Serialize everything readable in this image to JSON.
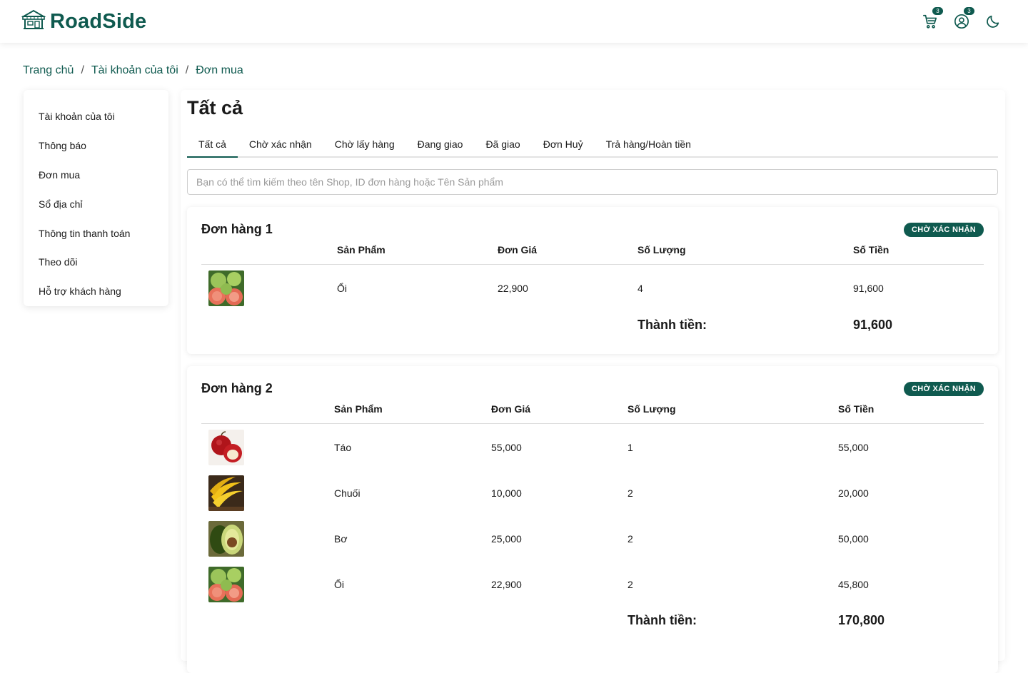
{
  "brand": {
    "name": "RoadSide"
  },
  "header": {
    "cart_count": "3",
    "notify_count": "3"
  },
  "colors": {
    "brand": "#0f5a4f",
    "badge": "#0f5a4f"
  },
  "breadcrumb": [
    "Trang chủ",
    "Tài khoản của tôi",
    "Đơn mua"
  ],
  "breadcrumb_sep": "/",
  "sidebar": {
    "items": [
      {
        "label": "Tài khoản của tôi"
      },
      {
        "label": "Thông báo"
      },
      {
        "label": "Đơn mua"
      },
      {
        "label": "Sổ địa chỉ"
      },
      {
        "label": "Thông tin thanh toán"
      },
      {
        "label": "Theo dõi"
      },
      {
        "label": "Hỗ trợ khách hàng"
      }
    ]
  },
  "main": {
    "title": "Tất cả",
    "tabs": [
      {
        "label": "Tất cả"
      },
      {
        "label": "Chờ xác nhận"
      },
      {
        "label": "Chờ lấy hàng"
      },
      {
        "label": "Đang giao"
      },
      {
        "label": "Đã giao"
      },
      {
        "label": "Đơn Huỷ"
      },
      {
        "label": "Trả hàng/Hoàn tiền"
      }
    ],
    "active_tab": "Tất cả",
    "search_placeholder": "Bạn có thể tìm kiếm theo tên Shop, ID đơn hàng hoặc Tên Sản phẩm",
    "search_value": ""
  },
  "table_headers": {
    "product": "Sản Phẩm",
    "price": "Đơn Giá",
    "quantity": "Số Lượng",
    "amount": "Số Tiền"
  },
  "total_label": "Thành tiền:",
  "orders": [
    {
      "title": "Đơn hàng 1",
      "status": "CHỜ XÁC NHẬN",
      "items": [
        {
          "icon": "guava-image",
          "name": "Ổi",
          "price": "22,900",
          "quantity": "4",
          "amount": "91,600"
        }
      ],
      "total": "91,600"
    },
    {
      "title": "Đơn hàng 2",
      "status": "CHỜ XÁC NHẬN",
      "items": [
        {
          "icon": "apple-image",
          "name": "Táo",
          "price": "55,000",
          "quantity": "1",
          "amount": "55,000"
        },
        {
          "icon": "banana-image",
          "name": "Chuối",
          "price": "10,000",
          "quantity": "2",
          "amount": "20,000"
        },
        {
          "icon": "avocado-image",
          "name": "Bơ",
          "price": "25,000",
          "quantity": "2",
          "amount": "50,000"
        },
        {
          "icon": "guava-image",
          "name": "Ổi",
          "price": "22,900",
          "quantity": "2",
          "amount": "45,800"
        }
      ],
      "total": "170,800"
    }
  ]
}
